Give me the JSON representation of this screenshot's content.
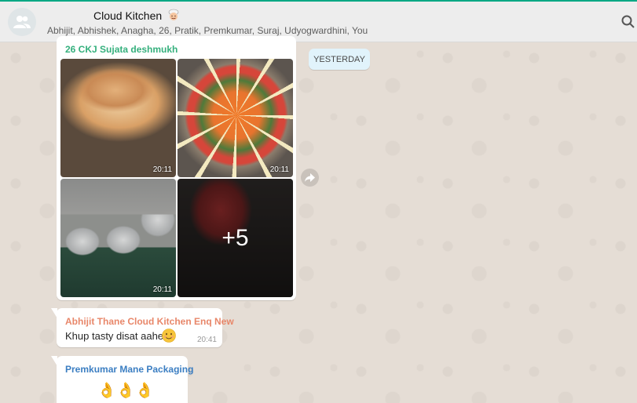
{
  "header": {
    "title": "Cloud Kitchen",
    "title_emoji": "chef-emoji",
    "participants": "Abhijit, Abhishek, Anagha, 26, Pratik, Premkumar, Suraj, Udyogwardhini, You"
  },
  "date_chip": "YESTERDAY",
  "album": {
    "sender": "26 CKJ Sujata deshmukh",
    "photos": [
      {
        "time": "20:11"
      },
      {
        "time": "20:11"
      },
      {
        "time": "20:11"
      },
      {
        "more": "+5"
      }
    ]
  },
  "messages": [
    {
      "sender": "Abhijit Thane Cloud Kitchen Enq New",
      "text": "Khup tasty disat aahe",
      "emoji": "smiling-face",
      "time": "20:41"
    },
    {
      "sender": "Premkumar Mane Packaging",
      "emojis": [
        "👌",
        "👌",
        "👌"
      ]
    }
  ],
  "colors": {
    "accent": "#00a884",
    "sender1": "#35b07d",
    "sender2": "#e8876a",
    "sender3": "#3b7ec2",
    "chat_bg": "#e5ddd5"
  }
}
